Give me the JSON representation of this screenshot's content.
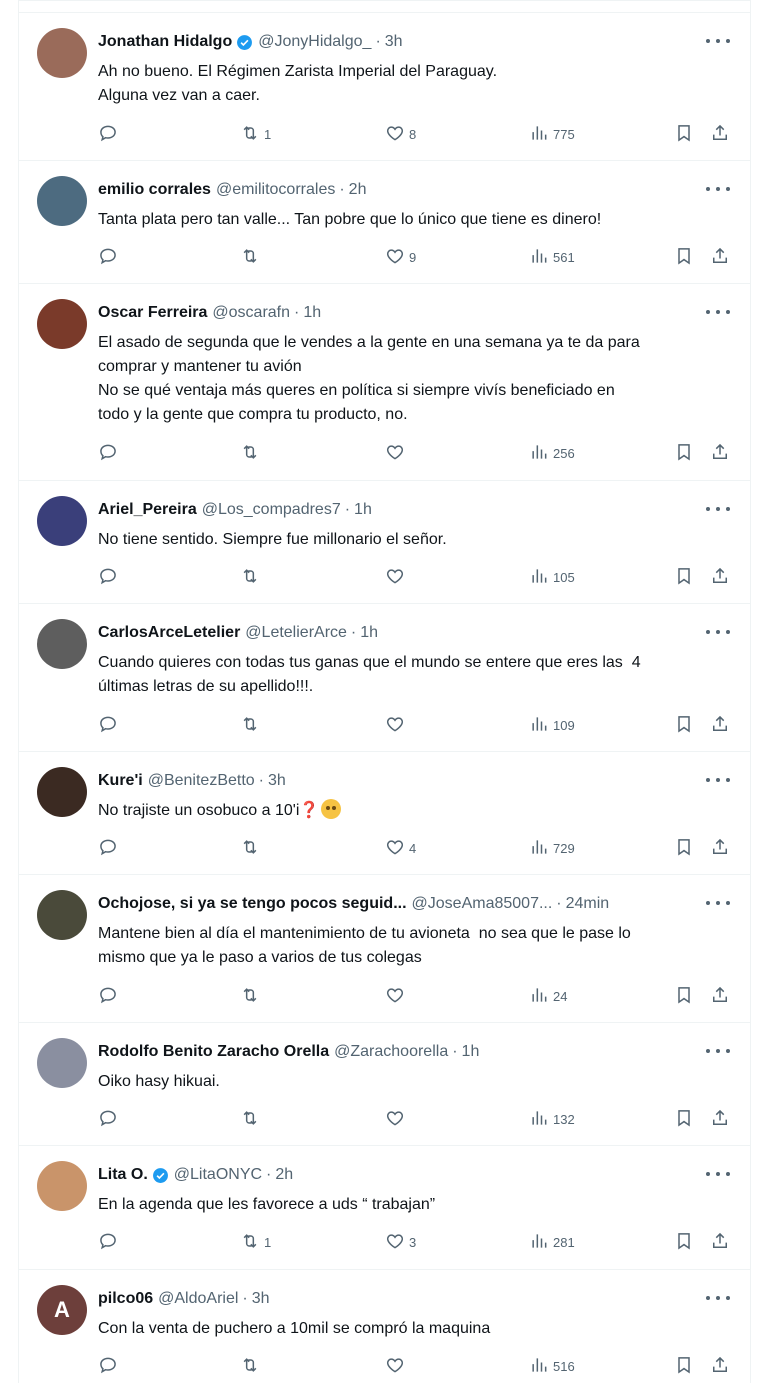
{
  "colors": {
    "accent": "#1d9bf0",
    "text": "#0f1419",
    "muted": "#536471",
    "divider": "#eff3f4"
  },
  "tweets": [
    {
      "name": "Jonathan Hidalgo",
      "verified": true,
      "handle": "@JonyHidalgo_",
      "time": "3h",
      "text": "Ah no bueno. El Régimen Zarista Imperial del Paraguay.\nAlguna vez van a caer.",
      "replies": "",
      "retweets": "1",
      "likes": "8",
      "views": "775",
      "avatar_color": "#9a6b5a"
    },
    {
      "name": "emilio corrales",
      "verified": false,
      "handle": "@emilitocorrales",
      "time": "2h",
      "text": "Tanta plata pero tan valle... Tan pobre que lo único que tiene es dinero!",
      "replies": "",
      "retweets": "",
      "likes": "9",
      "views": "561",
      "avatar_color": "#4d6b80"
    },
    {
      "name": "Oscar Ferreira",
      "verified": false,
      "handle": "@oscarafn",
      "time": "1h",
      "text": "El asado de segunda que le vendes a la gente en una semana ya te da para\ncomprar y mantener tu avión\nNo se qué ventaja más queres en política si siempre vivís beneficiado en\ntodo y la gente que compra tu producto, no.",
      "replies": "",
      "retweets": "",
      "likes": "",
      "views": "256",
      "avatar_color": "#7a3a2a"
    },
    {
      "name": "Ariel_Pereira",
      "verified": false,
      "handle": "@Los_compadres7",
      "time": "1h",
      "text": "No tiene sentido. Siempre fue millonario el señor.",
      "replies": "",
      "retweets": "",
      "likes": "",
      "views": "105",
      "avatar_color": "#3a3f7a"
    },
    {
      "name": "CarlosArceLetelier",
      "verified": false,
      "handle": "@LetelierArce",
      "time": "1h",
      "text": "Cuando quieres con todas tus ganas que el mundo se entere que eres las  4\núltimas letras de su apellido!!!.",
      "replies": "",
      "retweets": "",
      "likes": "",
      "views": "109",
      "avatar_color": "#5e5e5e"
    },
    {
      "name": "Kure'i",
      "verified": false,
      "handle": "@BenitezBetto",
      "time": "3h",
      "text": "No trajiste un osobuco a 10'i",
      "emoji_q": "❓",
      "replies": "",
      "retweets": "",
      "likes": "4",
      "views": "729",
      "avatar_color": "#3b2a22"
    },
    {
      "name": "Ochojose, si ya se tengo pocos seguid...",
      "verified": false,
      "handle": "@JoseAma85007...",
      "time": "24min",
      "text": "Mantene bien al día el mantenimiento de tu avioneta  no sea que le pase lo\nmismo que ya le paso a varios de tus colegas",
      "replies": "",
      "retweets": "",
      "likes": "",
      "views": "24",
      "avatar_color": "#4a4a3a"
    },
    {
      "name": "Rodolfo Benito Zaracho Orella",
      "verified": false,
      "handle": "@Zarachoorella",
      "time": "1h",
      "text": "Oiko hasy hikuai.",
      "replies": "",
      "retweets": "",
      "likes": "",
      "views": "132",
      "avatar_color": "#8a8fa0"
    },
    {
      "name": "Lita O.",
      "verified": true,
      "handle": "@LitaONYC",
      "time": "2h",
      "text": "En la agenda que les favorece a uds “ trabajan”",
      "replies": "",
      "retweets": "1",
      "likes": "3",
      "views": "281",
      "avatar_color": "#c9946a"
    },
    {
      "name": "pilco06",
      "verified": false,
      "handle": "@AldoAriel",
      "time": "3h",
      "text": "Con la venta de puchero a 10mil se compró la maquina",
      "replies": "",
      "retweets": "",
      "likes": "",
      "views": "516",
      "avatar_color": "#6d3f3b",
      "avatar_letter": "A"
    }
  ]
}
